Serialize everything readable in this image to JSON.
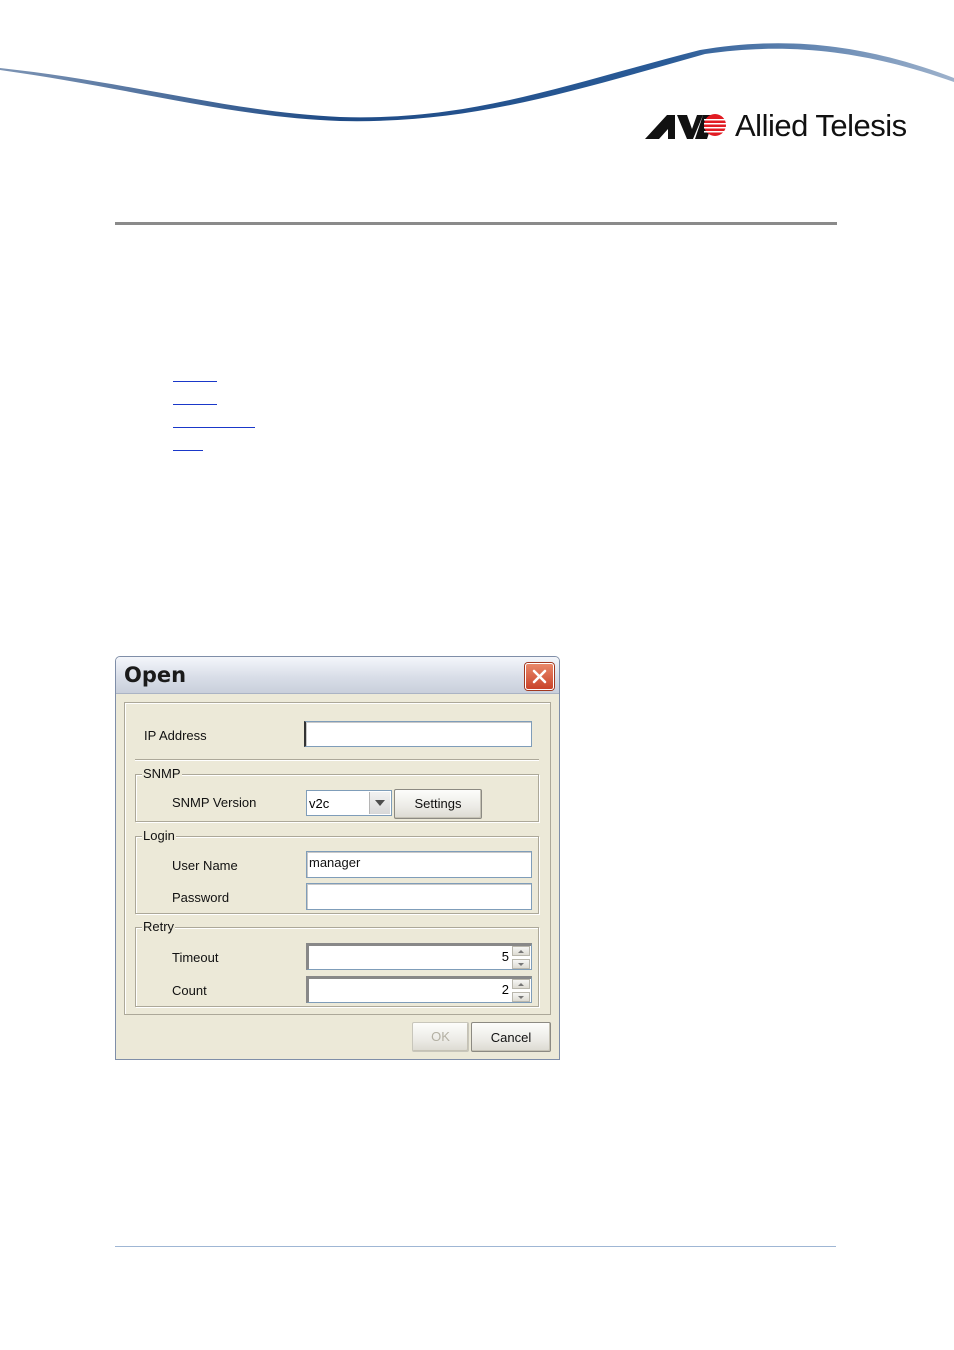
{
  "brand": {
    "logo_text": "Allied Telesis",
    "accent_color": "#e11b22",
    "swoosh_color": "#1f4b86"
  },
  "dialog": {
    "title": "Open",
    "close_icon": "close-icon",
    "ip_address": {
      "label": "IP Address",
      "value": ""
    },
    "snmp": {
      "group_title": "SNMP",
      "version_label": "SNMP Version",
      "version_value": "v2c",
      "settings_label": "Settings"
    },
    "login": {
      "group_title": "Login",
      "username_label": "User Name",
      "username_value": "manager",
      "password_label": "Password",
      "password_value": ""
    },
    "retry": {
      "group_title": "Retry",
      "timeout_label": "Timeout",
      "timeout_value": "5",
      "count_label": "Count",
      "count_value": "2"
    },
    "ok_label": "OK",
    "cancel_label": "Cancel"
  }
}
